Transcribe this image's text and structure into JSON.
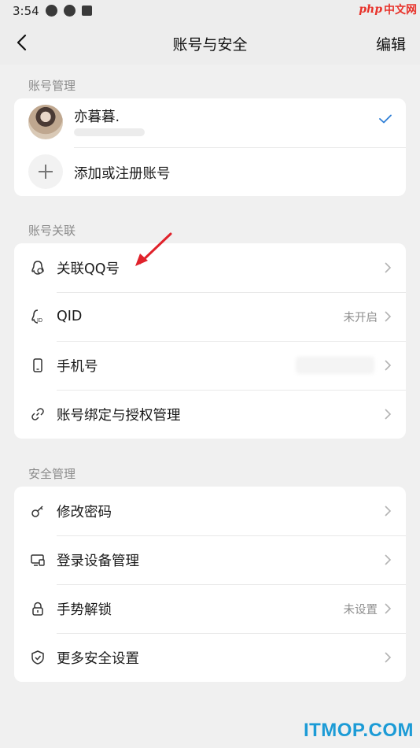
{
  "status_bar": {
    "time": "3:54"
  },
  "watermark_top": {
    "brand": "php",
    "suffix": "中文网"
  },
  "header": {
    "title": "账号与安全",
    "edit_label": "编辑"
  },
  "account_management": {
    "section_label": "账号管理",
    "account_name": "亦暮暮.",
    "add_account_label": "添加或注册账号"
  },
  "account_link": {
    "section_label": "账号关联",
    "items": [
      {
        "label": "关联QQ号",
        "value": ""
      },
      {
        "label": "QID",
        "value": "未开启"
      },
      {
        "label": "手机号",
        "value": ""
      },
      {
        "label": "账号绑定与授权管理",
        "value": ""
      }
    ]
  },
  "security": {
    "section_label": "安全管理",
    "items": [
      {
        "label": "修改密码",
        "value": ""
      },
      {
        "label": "登录设备管理",
        "value": ""
      },
      {
        "label": "手势解锁",
        "value": "未设置"
      },
      {
        "label": "更多安全设置",
        "value": ""
      }
    ]
  },
  "watermark_bottom": "ITMOP.COM",
  "colors": {
    "accent_check": "#2f7fd6",
    "annotation_arrow": "#e0222b",
    "watermark": "#1c9bd6"
  }
}
